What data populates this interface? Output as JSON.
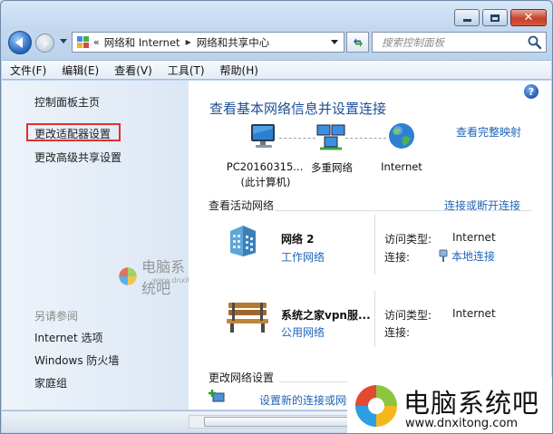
{
  "window": {
    "address": {
      "crumbs": [
        "网络和 Internet",
        "网络和共享中心"
      ]
    },
    "search_placeholder": "搜索控制面板"
  },
  "menu": [
    "文件(F)",
    "编辑(E)",
    "查看(V)",
    "工具(T)",
    "帮助(H)"
  ],
  "left_pane": {
    "links": [
      "控制面板主页",
      "更改适配器设置",
      "更改高级共享设置"
    ],
    "see_also_title": "另请参阅",
    "see_also_links": [
      "Internet 选项",
      "Windows 防火墙",
      "家庭组"
    ]
  },
  "main": {
    "title": "查看基本网络信息并设置连接",
    "full_map_link": "查看完整映射",
    "map_nodes": [
      {
        "label": "PC20160315...",
        "sub": "(此计算机)"
      },
      {
        "label": "多重网络"
      },
      {
        "label": "Internet"
      }
    ],
    "active_networks_title": "查看活动网络",
    "connect_link": "连接或断开连接",
    "networks": [
      {
        "name": "网络  2",
        "type": "工作网络",
        "access_label": "访问类型:",
        "access_value": "Internet",
        "conn_label": "连接:",
        "conn_value": "本地连接"
      },
      {
        "name": "系统之家vpn服...",
        "type": "公用网络",
        "access_label": "访问类型:",
        "access_value": "Internet",
        "conn_label": "连接:",
        "conn_value": ""
      }
    ],
    "change_settings_title": "更改网络设置",
    "task_link": "设置新的连接或网络"
  },
  "watermark": {
    "small_text": "电脑系统吧",
    "small_url": "www.dnxitong.com",
    "big_text": "电脑系统吧",
    "big_url": "www.dnxitong.com"
  }
}
